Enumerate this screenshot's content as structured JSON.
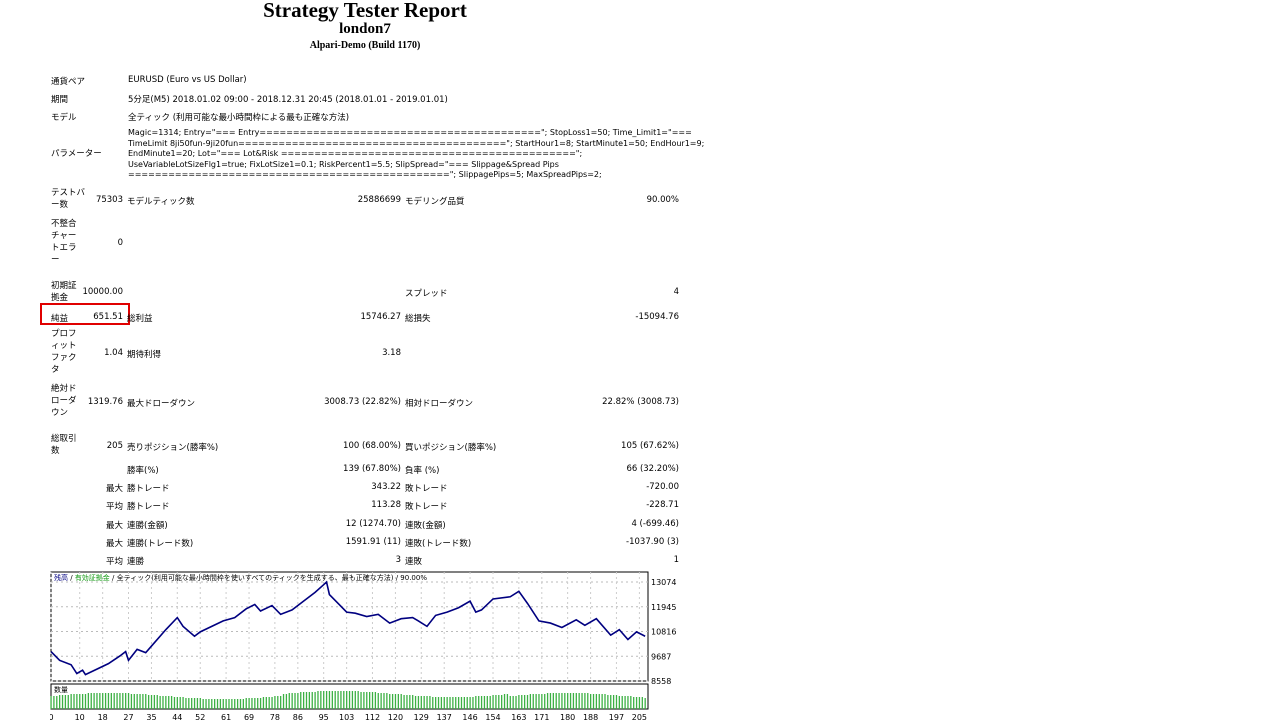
{
  "header": {
    "title": "Strategy Tester Report",
    "ea": "london7",
    "server": "Alpari-Demo (Build 1170)"
  },
  "info": [
    {
      "label": "通貨ペア",
      "value": "EURUSD (Euro vs US Dollar)"
    },
    {
      "label": "期間",
      "value": "5分足(M5) 2018.01.02 09:00 - 2018.12.31 20:45 (2018.01.01 - 2019.01.01)"
    },
    {
      "label": "モデル",
      "value": "全ティック (利用可能な最小時間枠による最も正確な方法)"
    },
    {
      "label": "パラメーター",
      "value": "Magic=1314; Entry=\"=== Entry==========================================\"; StopLoss1=50; Time_Limit1=\"===\nTimeLimit 8ji50fun-9ji20fun========================================\"; StartHour1=8; StartMinute1=50; EndHour1=9;\nEndMinute1=20; Lot=\"=== Lot&Risk ============================================\";\nUseVariableLotSizeFlg1=true; FixLotSize1=0.1; RiskPercent1=5.5; SlipSpread=\"=== Slippage&Spread Pips\n================================================\"; SlippagePips=5; MaxSpreadPips=2;"
    }
  ],
  "stats": {
    "bars_label": "テストバー数",
    "bars": "75303",
    "ticks_label": "モデルティック数",
    "ticks": "25886699",
    "quality_label": "モデリング品質",
    "quality": "90.00%",
    "mismatch_label": "不整合チャートエラー",
    "mismatch": "0",
    "deposit_label": "初期証拠金",
    "deposit": "10000.00",
    "spread_label": "スプレッド",
    "spread": "4",
    "net_label": "純益",
    "net": "651.51",
    "gross_profit_label": "総利益",
    "gross_profit": "15746.27",
    "gross_loss_label": "総損失",
    "gross_loss": "-15094.76",
    "pf_label": "プロフィットファクタ",
    "pf": "1.04",
    "payoff_label": "期待利得",
    "payoff": "3.18",
    "abs_dd_label": "絶対ドローダウン",
    "abs_dd": "1319.76",
    "max_dd_label": "最大ドローダウン",
    "max_dd": "3008.73 (22.82%)",
    "rel_dd_label": "相対ドローダウン",
    "rel_dd": "22.82% (3008.73)",
    "trades_label": "総取引数",
    "trades": "205",
    "short_label": "売りポジション(勝率%)",
    "short": "100 (68.00%)",
    "long_label": "買いポジション(勝率%)",
    "long": "105 (67.62%)",
    "rows": [
      {
        "pre": "",
        "l1": "勝率(%)",
        "v1": "139 (67.80%)",
        "l2": "負率 (%)",
        "v2": "66 (32.20%)"
      },
      {
        "pre": "最大",
        "l1": "勝トレード",
        "v1": "343.22",
        "l2": "敗トレード",
        "v2": "-720.00"
      },
      {
        "pre": "平均",
        "l1": "勝トレード",
        "v1": "113.28",
        "l2": "敗トレード",
        "v2": "-228.71"
      },
      {
        "pre": "最大",
        "l1": "連勝(金額)",
        "v1": "12 (1274.70)",
        "l2": "連敗(金額)",
        "v2": "4 (-699.46)"
      },
      {
        "pre": "最大",
        "l1": "連勝(トレード数)",
        "v1": "1591.91 (11)",
        "l2": "連敗(トレード数)",
        "v2": "-1037.90 (3)"
      },
      {
        "pre": "平均",
        "l1": "連勝",
        "v1": "3",
        "l2": "連敗",
        "v2": "1"
      }
    ]
  },
  "chart_data": {
    "type": "line",
    "legend": {
      "balance": "残高",
      "equity": "有効証拠金",
      "model": "全ティック(利用可能な最小時間枠を使いすべてのティックを生成する、最も正確な方法)",
      "quality": "90.00%"
    },
    "volume_label": "数量",
    "x_ticks": [
      0,
      10,
      18,
      27,
      35,
      44,
      52,
      61,
      69,
      78,
      86,
      95,
      103,
      112,
      120,
      129,
      137,
      146,
      154,
      163,
      171,
      180,
      188,
      197,
      205
    ],
    "y_ticks": [
      13074,
      11945,
      10816,
      9687,
      8558
    ],
    "xlim": [
      0,
      208
    ],
    "ylim": [
      8558,
      13400
    ],
    "colors": {
      "balance": "#000080",
      "volume": "#3cb043",
      "highlight": "#e00000"
    },
    "series": [
      {
        "x": [
          0,
          3,
          7,
          9,
          11,
          12,
          16,
          20,
          24,
          26,
          27,
          30,
          33,
          36,
          40,
          44,
          46,
          50,
          52,
          56,
          60,
          64,
          68,
          71,
          73,
          77,
          80,
          84,
          88,
          92,
          95,
          96,
          97,
          100,
          103,
          106,
          110,
          114,
          118,
          122,
          126,
          128,
          131,
          134,
          138,
          142,
          146,
          148,
          150,
          154,
          160,
          163,
          166,
          170,
          174,
          178,
          183,
          186,
          190,
          195,
          198,
          201,
          204,
          207
        ],
        "y": [
          9900,
          9500,
          9300,
          8900,
          9050,
          8850,
          9100,
          9350,
          9700,
          9900,
          9500,
          10000,
          9850,
          10300,
          10900,
          11450,
          11050,
          10600,
          10800,
          11050,
          11300,
          11450,
          11850,
          12050,
          11750,
          12000,
          11600,
          11800,
          12200,
          12600,
          12950,
          13074,
          12500,
          12100,
          11700,
          11650,
          11500,
          11600,
          11200,
          11400,
          11450,
          11300,
          11050,
          11550,
          11700,
          11900,
          12200,
          11700,
          11800,
          12300,
          12400,
          12650,
          12100,
          11300,
          11200,
          11000,
          11350,
          11100,
          11400,
          10650,
          10900,
          10450,
          10800,
          10600
        ]
      }
    ]
  }
}
